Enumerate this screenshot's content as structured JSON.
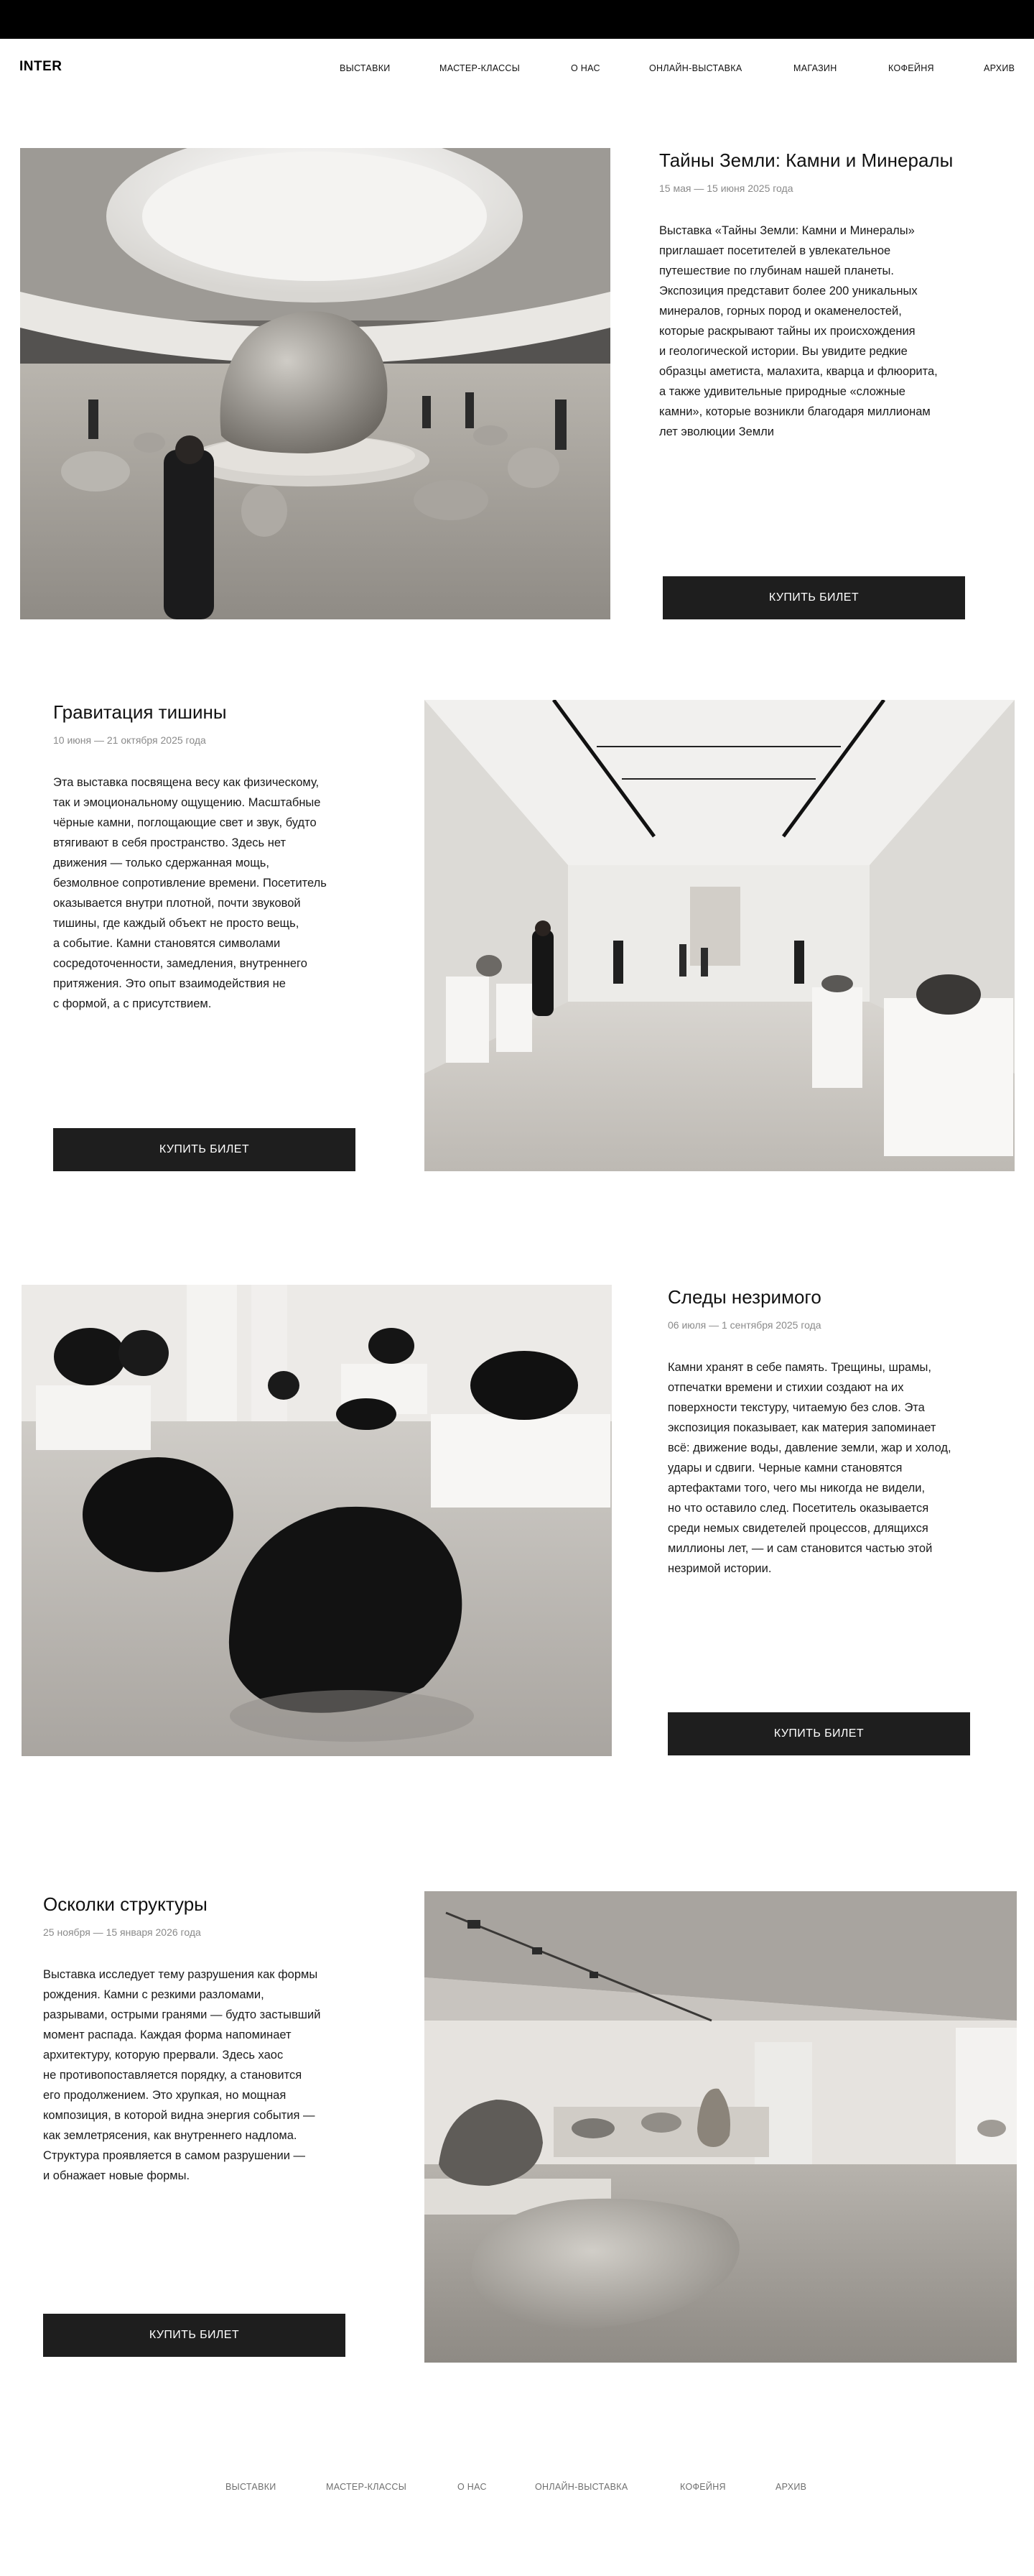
{
  "header": {
    "logo": "INTER",
    "nav": [
      "ВЫСТАВКИ",
      "МАСТЕР-КЛАССЫ",
      "О НАС",
      "ОНЛАЙН-ВЫСТАВКА",
      "МАГАЗИН",
      "КОФЕЙНЯ",
      "АРХИВ"
    ]
  },
  "exhibitions": [
    {
      "title": "Тайны Земли: Камни и Минералы",
      "dates": "15 мая — 15 июня 2025 года",
      "description": "Выставка «Тайны Земли: Камни и Минералы»\nприглашает посетителей в увлекательное\nпутешествие по глубинам нашей планеты.\nЭкспозиция представит более 200 уникальных\nминералов, горных пород и окаменелостей,\nкоторые раскрывают тайны их происхождения\nи геологической истории. Вы увидите редкие\nобразцы аметиста, малахита, кварца и флюорита,\nа также удивительные природные «сложные\nкамни», которые возникли благодаря миллионам\nлет эволюции Земли",
      "button": "КУПИТЬ БИЛЕТ"
    },
    {
      "title": "Гравитация тишины",
      "dates": "10 июня — 21 октября 2025 года",
      "description": "Эта выставка посвящена весу как физическому,\nтак и эмоциональному ощущению. Масштабные\nчёрные камни, поглощающие свет и звук, будто\nвтягивают в себя пространство. Здесь нет\nдвижения — только сдержанная мощь,\nбезмолвное сопротивление времени. Посетитель\nоказывается внутри плотной, почти звуковой\nтишины, где каждый объект не просто вещь,\nа событие. Камни становятся символами\nсосредоточенности, замедления, внутреннего\nпритяжения. Это опыт взаимодействия не\nс формой, а с присутствием.",
      "button": "КУПИТЬ БИЛЕТ"
    },
    {
      "title": "Следы незримого",
      "dates": "06 июля — 1 сентября 2025 года",
      "description": "Камни хранят в себе память. Трещины, шрамы,\nотпечатки времени и стихии создают на их\nповерхности текстуру, читаемую без слов. Эта\nэкспозиция показывает, как материя запоминает\nвсё: движение воды, давление земли, жар и холод,\nудары и сдвиги. Черные камни становятся\nартефактами того, чего мы никогда не видели,\nно что оставило след. Посетитель оказывается\nсреди немых свидетелей процессов, длящихся\nмиллионы лет, — и сам становится частью этой\nнезримой истории.",
      "button": "КУПИТЬ БИЛЕТ"
    },
    {
      "title": "Осколки структуры",
      "dates": "25 ноября — 15 января 2026 года",
      "description": "Выставка исследует тему разрушения как формы\nрождения. Камни с резкими разломами,\nразрывами, острыми гранями — будто застывший\nмомент распада. Каждая форма напоминает\nархитектуру, которую прервали. Здесь хаос\nне противопоставляется порядку, а становится\nего продолжением. Это хрупкая, но мощная\nкомпозиция, в которой видна энергия события —\nкак землетрясения, как внутреннего надлома.\nСтруктура проявляется в самом разрушении —\nи обнажает новые формы.",
      "button": "КУПИТЬ БИЛЕТ"
    }
  ],
  "footer": {
    "nav": [
      "ВЫСТАВКИ",
      "МАСТЕР-КЛАССЫ",
      "О НАС",
      "ОНЛАЙН-ВЫСТАВКА",
      "КОФЕЙНЯ",
      "АРХИВ"
    ]
  },
  "colors": {
    "topbar": "#000000",
    "button": "#1e1e1e",
    "dates": "#8a8a8a"
  }
}
